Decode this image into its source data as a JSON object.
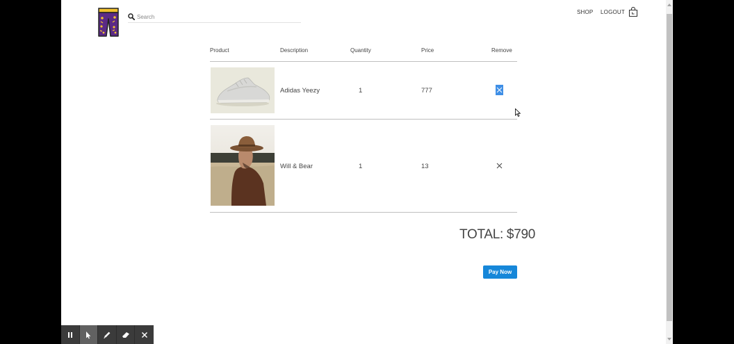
{
  "header": {
    "search_placeholder": "Search",
    "nav": {
      "shop": "SHOP",
      "logout": "LOGOUT"
    }
  },
  "cart": {
    "columns": [
      "Product",
      "Description",
      "Quantity",
      "Price",
      "Remove"
    ],
    "items": [
      {
        "description": "Adidas Yeezy",
        "quantity": "1",
        "price": "777",
        "remove_selected": true
      },
      {
        "description": "Will & Bear",
        "quantity": "1",
        "price": "13",
        "remove_selected": false
      }
    ],
    "total": "TOTAL: $790",
    "pay_label": "Pay Now"
  },
  "recorder": {
    "buttons": [
      "pause-icon",
      "pointer-icon",
      "pen-icon",
      "eraser-icon",
      "close-icon"
    ]
  },
  "colors": {
    "accent": "#1687d9",
    "selection": "#3f8fe6",
    "logo_purple": "#5b2a86",
    "logo_yellow": "#f2c12e"
  }
}
